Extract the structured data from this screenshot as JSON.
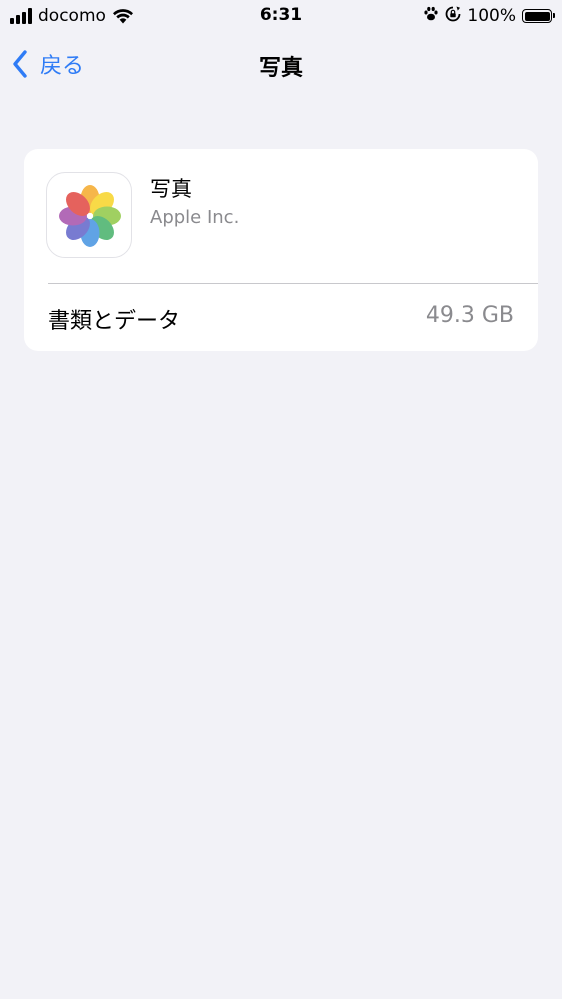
{
  "status_bar": {
    "carrier": "docomo",
    "time": "6:31",
    "battery_percent": "100%"
  },
  "nav": {
    "back_label": "戻る",
    "title": "写真"
  },
  "app": {
    "name": "写真",
    "developer": "Apple Inc.",
    "icon": "photos-app-icon"
  },
  "storage": {
    "label": "書類とデータ",
    "value": "49.3 GB"
  },
  "colors": {
    "background": "#f2f2f7",
    "accent": "#2f7cf6",
    "secondary_text": "#8a8a8e"
  }
}
